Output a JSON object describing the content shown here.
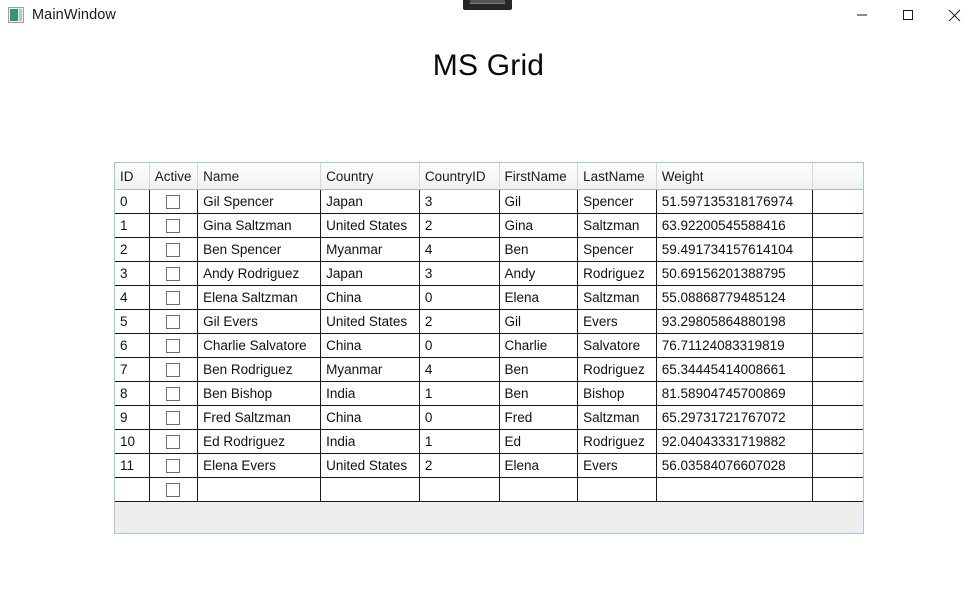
{
  "window": {
    "title": "MainWindow",
    "icon": "app-window-icon",
    "controls": [
      {
        "name": "minimize",
        "glyph": "minimize-icon"
      },
      {
        "name": "maximize",
        "glyph": "maximize-icon"
      },
      {
        "name": "close",
        "glyph": "close-icon"
      }
    ]
  },
  "page": {
    "heading": "MS Grid"
  },
  "grid": {
    "columns": [
      "ID",
      "Active",
      "Name",
      "Country",
      "CountryID",
      "FirstName",
      "LastName",
      "Weight",
      ""
    ],
    "rows": [
      {
        "id": "0",
        "active": false,
        "name": "Gil Spencer",
        "country": "Japan",
        "countryId": "3",
        "firstName": "Gil",
        "lastName": "Spencer",
        "weight": "51.597135318176974"
      },
      {
        "id": "1",
        "active": false,
        "name": "Gina Saltzman",
        "country": "United States",
        "countryId": "2",
        "firstName": "Gina",
        "lastName": "Saltzman",
        "weight": "63.92200545588416"
      },
      {
        "id": "2",
        "active": false,
        "name": "Ben Spencer",
        "country": "Myanmar",
        "countryId": "4",
        "firstName": "Ben",
        "lastName": "Spencer",
        "weight": "59.491734157614104"
      },
      {
        "id": "3",
        "active": false,
        "name": "Andy Rodriguez",
        "country": "Japan",
        "countryId": "3",
        "firstName": "Andy",
        "lastName": "Rodriguez",
        "weight": "50.69156201388795"
      },
      {
        "id": "4",
        "active": false,
        "name": "Elena Saltzman",
        "country": "China",
        "countryId": "0",
        "firstName": "Elena",
        "lastName": "Saltzman",
        "weight": "55.08868779485124"
      },
      {
        "id": "5",
        "active": false,
        "name": "Gil Evers",
        "country": "United States",
        "countryId": "2",
        "firstName": "Gil",
        "lastName": "Evers",
        "weight": "93.29805864880198"
      },
      {
        "id": "6",
        "active": false,
        "name": "Charlie Salvatore",
        "country": "China",
        "countryId": "0",
        "firstName": "Charlie",
        "lastName": "Salvatore",
        "weight": "76.71124083319819"
      },
      {
        "id": "7",
        "active": false,
        "name": "Ben Rodriguez",
        "country": "Myanmar",
        "countryId": "4",
        "firstName": "Ben",
        "lastName": "Rodriguez",
        "weight": "65.34445414008661"
      },
      {
        "id": "8",
        "active": false,
        "name": "Ben Bishop",
        "country": "India",
        "countryId": "1",
        "firstName": "Ben",
        "lastName": "Bishop",
        "weight": "81.58904745700869"
      },
      {
        "id": "9",
        "active": false,
        "name": "Fred Saltzman",
        "country": "China",
        "countryId": "0",
        "firstName": "Fred",
        "lastName": "Saltzman",
        "weight": "65.29731721767072"
      },
      {
        "id": "10",
        "active": false,
        "name": "Ed Rodriguez",
        "country": "India",
        "countryId": "1",
        "firstName": "Ed",
        "lastName": "Rodriguez",
        "weight": "92.04043331719882"
      },
      {
        "id": "11",
        "active": false,
        "name": "Elena Evers",
        "country": "United States",
        "countryId": "2",
        "firstName": "Elena",
        "lastName": "Evers",
        "weight": "56.03584076607028"
      },
      {
        "id": "",
        "active": false,
        "name": "",
        "country": "",
        "countryId": "",
        "firstName": "",
        "lastName": "",
        "weight": ""
      }
    ]
  },
  "colors": {
    "grid_border": "#a9c3db",
    "header_bg": "#f5f6f7",
    "cell_border": "#1a1a1a",
    "filler_bg": "#eeeeee",
    "icon_accent": "#3f8f73"
  }
}
